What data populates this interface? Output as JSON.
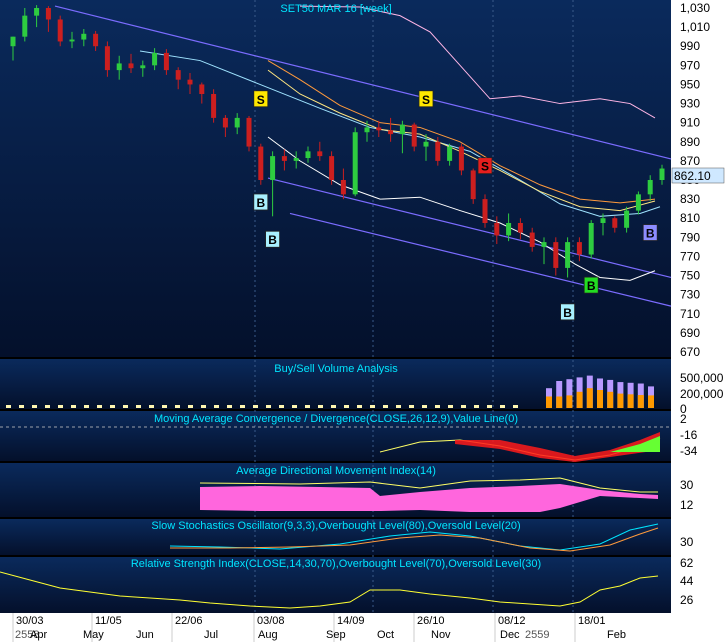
{
  "colors": {
    "panel_top": "#0a2a5c",
    "panel_bottom": "#050f2a",
    "axis_bg": "#ffffff",
    "title_text": "#00e5ff",
    "price_badge_bg": "#cfe8ff",
    "up_candle": "#2ecc40",
    "down_candle": "#cc1f1f",
    "channel_line": "#7b6cff",
    "ma_fast": "#9fe3ff",
    "ma_mid": "#ffe680",
    "ma_slow": "#ff9a3c",
    "ma_long": "#ffb6e6",
    "adx_fill": "#ff66dd",
    "vol_buy": "#ff9900",
    "vol_sell": "#b899ff"
  },
  "chart_data": [
    {
      "type": "candlestick",
      "title": "SET50 MAR 16  [week]",
      "last_price": "862.10",
      "y_ticks": [
        "1,030",
        "1,010",
        "990",
        "970",
        "950",
        "930",
        "910",
        "890",
        "870",
        "850",
        "830",
        "810",
        "790",
        "770",
        "750",
        "730",
        "710",
        "690",
        "670"
      ],
      "ylim": [
        670,
        1040
      ],
      "x_date_labels": [
        "30/03",
        "11/05",
        "22/06",
        "03/08",
        "14/09",
        "26/10",
        "08/12",
        "18/01"
      ],
      "x_month_labels": [
        "2558",
        "Apr",
        "May",
        "Jun",
        "Jul",
        "Aug",
        "Sep",
        "Oct",
        "Nov",
        "Dec",
        "2559",
        "Feb"
      ],
      "candles": [
        {
          "o": 990,
          "h": 1000,
          "l": 975,
          "c": 1000
        },
        {
          "o": 1000,
          "h": 1030,
          "l": 995,
          "c": 1022
        },
        {
          "o": 1022,
          "h": 1033,
          "l": 1010,
          "c": 1030
        },
        {
          "o": 1030,
          "h": 1032,
          "l": 1005,
          "c": 1018
        },
        {
          "o": 1018,
          "h": 1022,
          "l": 990,
          "c": 995
        },
        {
          "o": 995,
          "h": 1005,
          "l": 988,
          "c": 997
        },
        {
          "o": 997,
          "h": 1008,
          "l": 990,
          "c": 1003
        },
        {
          "o": 1003,
          "h": 1006,
          "l": 985,
          "c": 990
        },
        {
          "o": 990,
          "h": 995,
          "l": 958,
          "c": 965
        },
        {
          "o": 965,
          "h": 980,
          "l": 955,
          "c": 972
        },
        {
          "o": 972,
          "h": 982,
          "l": 962,
          "c": 967
        },
        {
          "o": 967,
          "h": 975,
          "l": 958,
          "c": 970
        },
        {
          "o": 970,
          "h": 988,
          "l": 965,
          "c": 983
        },
        {
          "o": 983,
          "h": 987,
          "l": 960,
          "c": 965
        },
        {
          "o": 965,
          "h": 968,
          "l": 945,
          "c": 955
        },
        {
          "o": 955,
          "h": 962,
          "l": 940,
          "c": 950
        },
        {
          "o": 950,
          "h": 952,
          "l": 930,
          "c": 940
        },
        {
          "o": 940,
          "h": 945,
          "l": 910,
          "c": 915
        },
        {
          "o": 915,
          "h": 918,
          "l": 895,
          "c": 905
        },
        {
          "o": 905,
          "h": 920,
          "l": 898,
          "c": 915
        },
        {
          "o": 915,
          "h": 917,
          "l": 880,
          "c": 885
        },
        {
          "o": 885,
          "h": 888,
          "l": 845,
          "c": 850
        },
        {
          "o": 850,
          "h": 880,
          "l": 812,
          "c": 875
        },
        {
          "o": 875,
          "h": 882,
          "l": 860,
          "c": 870
        },
        {
          "o": 870,
          "h": 880,
          "l": 862,
          "c": 873
        },
        {
          "o": 873,
          "h": 885,
          "l": 868,
          "c": 880
        },
        {
          "o": 880,
          "h": 890,
          "l": 870,
          "c": 875
        },
        {
          "o": 875,
          "h": 880,
          "l": 845,
          "c": 850
        },
        {
          "o": 850,
          "h": 862,
          "l": 830,
          "c": 835
        },
        {
          "o": 835,
          "h": 905,
          "l": 833,
          "c": 900
        },
        {
          "o": 900,
          "h": 912,
          "l": 890,
          "c": 905
        },
        {
          "o": 905,
          "h": 912,
          "l": 895,
          "c": 902
        },
        {
          "o": 902,
          "h": 915,
          "l": 890,
          "c": 898
        },
        {
          "o": 898,
          "h": 912,
          "l": 878,
          "c": 908
        },
        {
          "o": 908,
          "h": 910,
          "l": 880,
          "c": 885
        },
        {
          "o": 885,
          "h": 898,
          "l": 870,
          "c": 890
        },
        {
          "o": 890,
          "h": 895,
          "l": 865,
          "c": 870
        },
        {
          "o": 870,
          "h": 888,
          "l": 865,
          "c": 885
        },
        {
          "o": 885,
          "h": 888,
          "l": 855,
          "c": 860
        },
        {
          "o": 860,
          "h": 862,
          "l": 825,
          "c": 830
        },
        {
          "o": 830,
          "h": 835,
          "l": 800,
          "c": 805
        },
        {
          "o": 805,
          "h": 812,
          "l": 783,
          "c": 792
        },
        {
          "o": 792,
          "h": 815,
          "l": 786,
          "c": 805
        },
        {
          "o": 805,
          "h": 810,
          "l": 788,
          "c": 795
        },
        {
          "o": 795,
          "h": 800,
          "l": 775,
          "c": 780
        },
        {
          "o": 780,
          "h": 790,
          "l": 762,
          "c": 785
        },
        {
          "o": 785,
          "h": 790,
          "l": 750,
          "c": 758
        },
        {
          "o": 758,
          "h": 790,
          "l": 748,
          "c": 785
        },
        {
          "o": 785,
          "h": 790,
          "l": 765,
          "c": 772
        },
        {
          "o": 772,
          "h": 808,
          "l": 768,
          "c": 805
        },
        {
          "o": 805,
          "h": 815,
          "l": 792,
          "c": 810
        },
        {
          "o": 810,
          "h": 812,
          "l": 795,
          "c": 800
        },
        {
          "o": 800,
          "h": 822,
          "l": 795,
          "c": 818
        },
        {
          "o": 818,
          "h": 838,
          "l": 814,
          "c": 835
        },
        {
          "o": 835,
          "h": 855,
          "l": 828,
          "c": 850
        },
        {
          "o": 850,
          "h": 866,
          "l": 845,
          "c": 862
        }
      ],
      "signals": [
        {
          "label": "S",
          "kind": "sell",
          "idx": 21,
          "price": 935
        },
        {
          "label": "B",
          "kind": "buy",
          "idx": 21,
          "price": 827
        },
        {
          "label": "B",
          "kind": "buy",
          "idx": 22,
          "price": 788
        },
        {
          "label": "S",
          "kind": "sell",
          "idx": 35,
          "price": 935
        },
        {
          "label": "S",
          "kind": "sell_red",
          "idx": 40,
          "price": 865
        },
        {
          "label": "B",
          "kind": "buy",
          "idx": 47,
          "price": 712
        },
        {
          "label": "B",
          "kind": "buy_green",
          "idx": 49,
          "price": 740
        },
        {
          "label": "B",
          "kind": "buy_blue",
          "idx": 54,
          "price": 795
        }
      ]
    },
    {
      "type": "bar",
      "title": "Buy/Sell Volume Analysis",
      "y_ticks": [
        "500,000",
        "200,000",
        "0"
      ],
      "buy": [
        0.32,
        0.32,
        0.35,
        0.45,
        0.55,
        0.5,
        0.45,
        0.4,
        0.38,
        0.36,
        0.35
      ],
      "sell": [
        0.55,
        0.75,
        0.8,
        0.85,
        0.9,
        0.82,
        0.78,
        0.72,
        0.7,
        0.68,
        0.6
      ]
    },
    {
      "type": "line",
      "title": "Moving Average Convergence / Divergence(CLOSE,26,12,9),Value Line(0)",
      "y_ticks": [
        "2",
        "-16",
        "-34"
      ]
    },
    {
      "type": "area",
      "title": "Average Directional Movement Index(14)",
      "y_ticks": [
        "30",
        "12"
      ]
    },
    {
      "type": "line",
      "title": "Slow Stochastics Oscillator(9,3,3),Overbought Level(80),Oversold Level(20)",
      "y_ticks": [
        "30"
      ]
    },
    {
      "type": "line",
      "title": "Relative Strength Index(CLOSE,14,30,70),Overbought Level(70),Oversold Level(30)",
      "y_ticks": [
        "62",
        "44",
        "26"
      ]
    }
  ]
}
